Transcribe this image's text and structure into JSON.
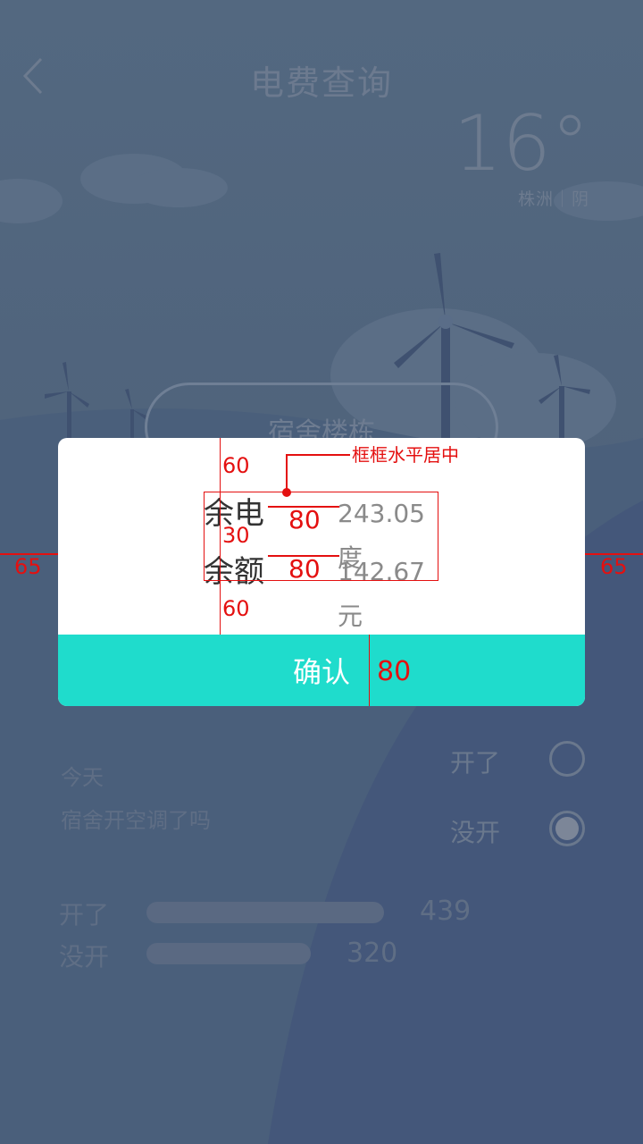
{
  "header": {
    "title": "电费查询"
  },
  "weather": {
    "temperature": "16°",
    "location": "株洲｜阴"
  },
  "selector": {
    "placeholder": "宿舍楼栋"
  },
  "dialog": {
    "rows": [
      {
        "label": "余电",
        "value": "243.05度"
      },
      {
        "label": "余额",
        "value": "142.67元"
      }
    ],
    "confirm_label": "确认"
  },
  "survey": {
    "today": "今天",
    "question": "宿舍开空调了吗",
    "option_yes": "开了",
    "option_no": "没开",
    "selected": "没开"
  },
  "stats": {
    "rows": [
      {
        "label": "开了",
        "count": "439"
      },
      {
        "label": "没开",
        "count": "320"
      }
    ]
  },
  "annotations": {
    "top_spacing": "60",
    "row_gap": "30",
    "bottom_spacing": "60",
    "side_margin_left": "65",
    "side_margin_right": "65",
    "line_len_1": "80",
    "line_len_2": "80",
    "button_height": "80",
    "center_note": "框框水平居中"
  },
  "colors": {
    "accent": "#1fdccc",
    "annotation": "#e41010",
    "background": "#4d6079"
  }
}
